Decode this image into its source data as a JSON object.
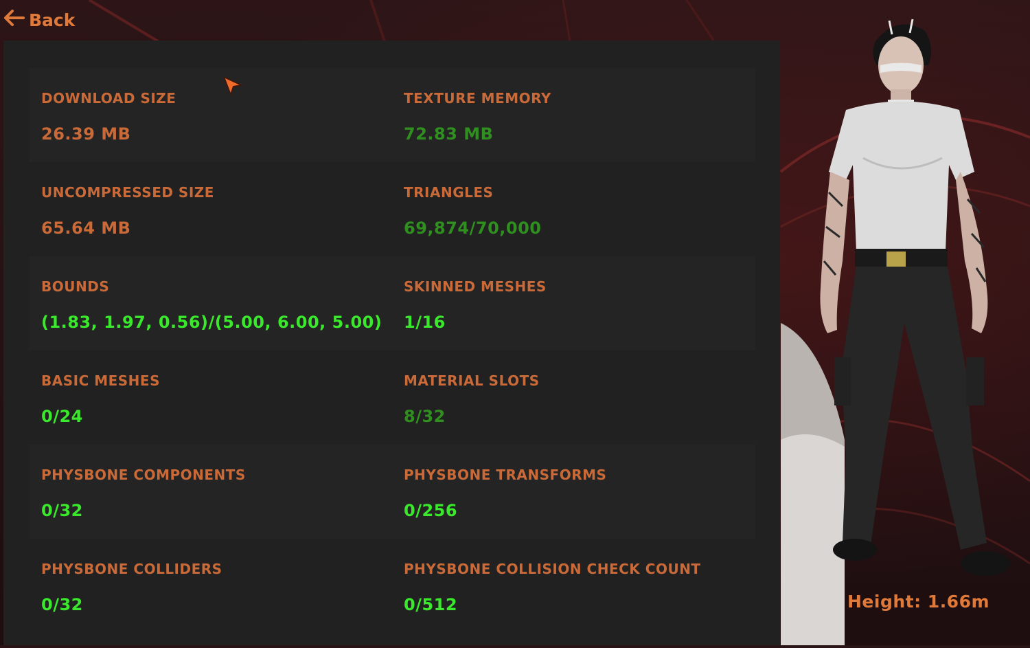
{
  "nav": {
    "back_label": "Back"
  },
  "stats": [
    {
      "label": "DOWNLOAD SIZE",
      "value": "26.39 MB",
      "status": "orange"
    },
    {
      "label": "TEXTURE MEMORY",
      "value": "72.83 MB",
      "status": "green"
    },
    {
      "label": "UNCOMPRESSED SIZE",
      "value": "65.64 MB",
      "status": "orange"
    },
    {
      "label": "TRIANGLES",
      "value": "69,874/70,000",
      "status": "green"
    },
    {
      "label": "BOUNDS",
      "value": "(1.83, 1.97, 0.56)/(5.00, 6.00, 5.00)",
      "status": "bright"
    },
    {
      "label": "SKINNED MESHES",
      "value": "1/16",
      "status": "bright"
    },
    {
      "label": "BASIC MESHES",
      "value": "0/24",
      "status": "bright"
    },
    {
      "label": "MATERIAL SLOTS",
      "value": "8/32",
      "status": "green"
    },
    {
      "label": "PHYSBONE COMPONENTS",
      "value": "0/32",
      "status": "bright"
    },
    {
      "label": "PHYSBONE TRANSFORMS",
      "value": "0/256",
      "status": "bright"
    },
    {
      "label": "PHYSBONE COLLIDERS",
      "value": "0/32",
      "status": "bright"
    },
    {
      "label": "PHYSBONE COLLISION CHECK COUNT",
      "value": "0/512",
      "status": "bright"
    }
  ],
  "avatar": {
    "height_label": "Height: 1.66m"
  },
  "colors": {
    "accent": "#e07a3a",
    "label": "#c96a38",
    "status_green": "#2f8f1f",
    "status_bright": "#3ae82c",
    "panel_bg": "#212121"
  }
}
